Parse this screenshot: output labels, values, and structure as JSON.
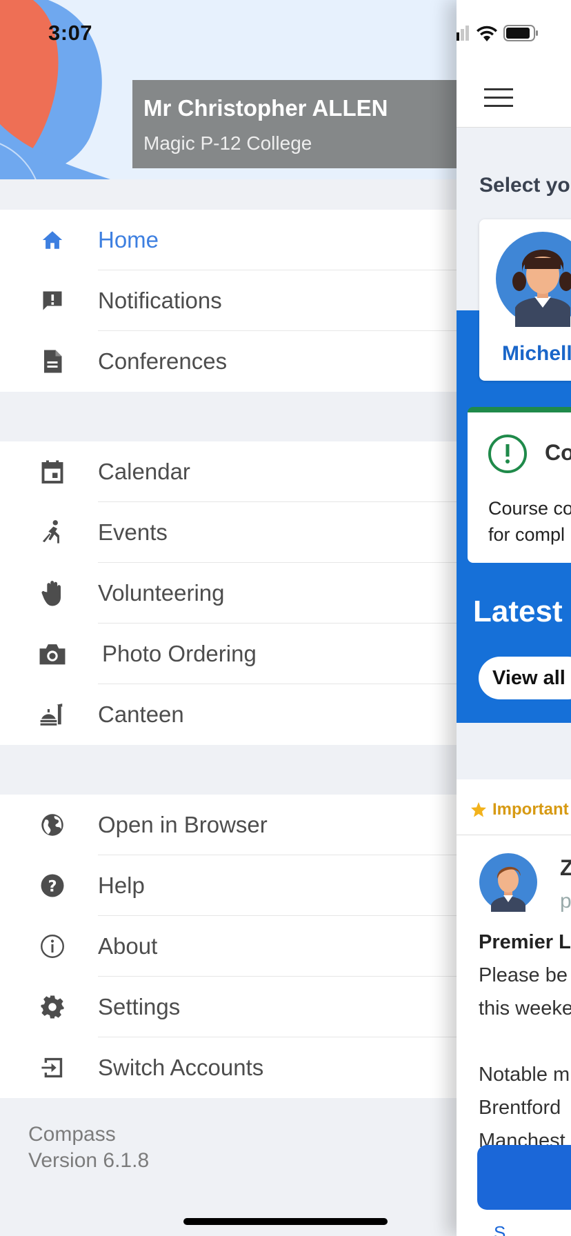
{
  "status_bar": {
    "time": "3:07"
  },
  "user": {
    "name": "Mr Christopher ALLEN",
    "school": "Magic P-12 College"
  },
  "menu": {
    "group1": [
      {
        "label": "Home",
        "icon": "home-icon",
        "active": true
      },
      {
        "label": "Notifications",
        "icon": "notification-alert-icon"
      },
      {
        "label": "Conferences",
        "icon": "document-icon"
      }
    ],
    "group2": [
      {
        "label": "Calendar",
        "icon": "calendar-icon"
      },
      {
        "label": "Events",
        "icon": "person-running-icon"
      },
      {
        "label": "Volunteering",
        "icon": "hand-icon"
      },
      {
        "label": "Photo Ordering",
        "icon": "camera-icon"
      },
      {
        "label": "Canteen",
        "icon": "food-service-icon"
      }
    ],
    "group3": [
      {
        "label": "Open in Browser",
        "icon": "globe-icon"
      },
      {
        "label": "Help",
        "icon": "help-icon"
      },
      {
        "label": "About",
        "icon": "info-icon"
      },
      {
        "label": "Settings",
        "icon": "gear-icon"
      },
      {
        "label": "Switch Accounts",
        "icon": "sign-in-icon"
      }
    ]
  },
  "footer": {
    "app_name": "Compass",
    "version": "Version 6.1.8"
  },
  "main": {
    "select_heading": "Select you",
    "student_name": "Michelle",
    "alert_title": "Co",
    "alert_line1": "Course co",
    "alert_line2": "for compl",
    "latest_heading": "Latest n",
    "view_all": "View all",
    "important_label": "Important",
    "poster_initial": "Z",
    "poster_sub": "p",
    "news_title": "Premier Le",
    "news_line1": "Please be",
    "news_line2": "this weeke",
    "news_line3": "Notable m",
    "news_line4": "Brentford",
    "news_line5": "Manchest",
    "bottom_cut": "S"
  },
  "colors": {
    "accent": "#3d7fe0",
    "brand_blue": "#1670d8",
    "alert_green": "#1f8a4a",
    "important_gold": "#d79a13"
  }
}
